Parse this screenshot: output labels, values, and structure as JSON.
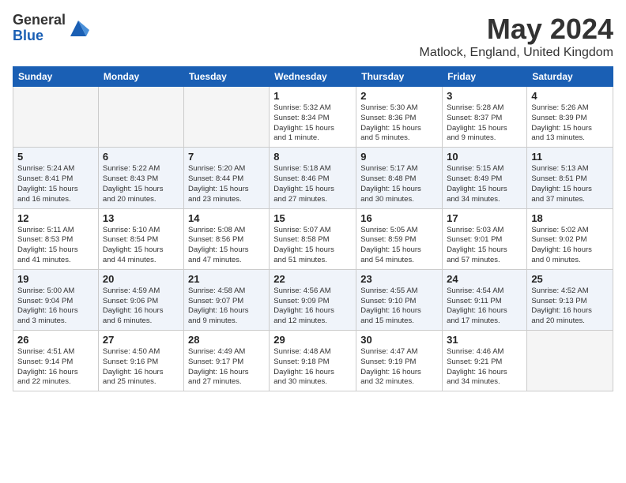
{
  "logo": {
    "general": "General",
    "blue": "Blue"
  },
  "title": "May 2024",
  "location": "Matlock, England, United Kingdom",
  "days_of_week": [
    "Sunday",
    "Monday",
    "Tuesday",
    "Wednesday",
    "Thursday",
    "Friday",
    "Saturday"
  ],
  "weeks": [
    [
      {
        "num": "",
        "info": ""
      },
      {
        "num": "",
        "info": ""
      },
      {
        "num": "",
        "info": ""
      },
      {
        "num": "1",
        "info": "Sunrise: 5:32 AM\nSunset: 8:34 PM\nDaylight: 15 hours\nand 1 minute."
      },
      {
        "num": "2",
        "info": "Sunrise: 5:30 AM\nSunset: 8:36 PM\nDaylight: 15 hours\nand 5 minutes."
      },
      {
        "num": "3",
        "info": "Sunrise: 5:28 AM\nSunset: 8:37 PM\nDaylight: 15 hours\nand 9 minutes."
      },
      {
        "num": "4",
        "info": "Sunrise: 5:26 AM\nSunset: 8:39 PM\nDaylight: 15 hours\nand 13 minutes."
      }
    ],
    [
      {
        "num": "5",
        "info": "Sunrise: 5:24 AM\nSunset: 8:41 PM\nDaylight: 15 hours\nand 16 minutes."
      },
      {
        "num": "6",
        "info": "Sunrise: 5:22 AM\nSunset: 8:43 PM\nDaylight: 15 hours\nand 20 minutes."
      },
      {
        "num": "7",
        "info": "Sunrise: 5:20 AM\nSunset: 8:44 PM\nDaylight: 15 hours\nand 23 minutes."
      },
      {
        "num": "8",
        "info": "Sunrise: 5:18 AM\nSunset: 8:46 PM\nDaylight: 15 hours\nand 27 minutes."
      },
      {
        "num": "9",
        "info": "Sunrise: 5:17 AM\nSunset: 8:48 PM\nDaylight: 15 hours\nand 30 minutes."
      },
      {
        "num": "10",
        "info": "Sunrise: 5:15 AM\nSunset: 8:49 PM\nDaylight: 15 hours\nand 34 minutes."
      },
      {
        "num": "11",
        "info": "Sunrise: 5:13 AM\nSunset: 8:51 PM\nDaylight: 15 hours\nand 37 minutes."
      }
    ],
    [
      {
        "num": "12",
        "info": "Sunrise: 5:11 AM\nSunset: 8:53 PM\nDaylight: 15 hours\nand 41 minutes."
      },
      {
        "num": "13",
        "info": "Sunrise: 5:10 AM\nSunset: 8:54 PM\nDaylight: 15 hours\nand 44 minutes."
      },
      {
        "num": "14",
        "info": "Sunrise: 5:08 AM\nSunset: 8:56 PM\nDaylight: 15 hours\nand 47 minutes."
      },
      {
        "num": "15",
        "info": "Sunrise: 5:07 AM\nSunset: 8:58 PM\nDaylight: 15 hours\nand 51 minutes."
      },
      {
        "num": "16",
        "info": "Sunrise: 5:05 AM\nSunset: 8:59 PM\nDaylight: 15 hours\nand 54 minutes."
      },
      {
        "num": "17",
        "info": "Sunrise: 5:03 AM\nSunset: 9:01 PM\nDaylight: 15 hours\nand 57 minutes."
      },
      {
        "num": "18",
        "info": "Sunrise: 5:02 AM\nSunset: 9:02 PM\nDaylight: 16 hours\nand 0 minutes."
      }
    ],
    [
      {
        "num": "19",
        "info": "Sunrise: 5:00 AM\nSunset: 9:04 PM\nDaylight: 16 hours\nand 3 minutes."
      },
      {
        "num": "20",
        "info": "Sunrise: 4:59 AM\nSunset: 9:06 PM\nDaylight: 16 hours\nand 6 minutes."
      },
      {
        "num": "21",
        "info": "Sunrise: 4:58 AM\nSunset: 9:07 PM\nDaylight: 16 hours\nand 9 minutes."
      },
      {
        "num": "22",
        "info": "Sunrise: 4:56 AM\nSunset: 9:09 PM\nDaylight: 16 hours\nand 12 minutes."
      },
      {
        "num": "23",
        "info": "Sunrise: 4:55 AM\nSunset: 9:10 PM\nDaylight: 16 hours\nand 15 minutes."
      },
      {
        "num": "24",
        "info": "Sunrise: 4:54 AM\nSunset: 9:11 PM\nDaylight: 16 hours\nand 17 minutes."
      },
      {
        "num": "25",
        "info": "Sunrise: 4:52 AM\nSunset: 9:13 PM\nDaylight: 16 hours\nand 20 minutes."
      }
    ],
    [
      {
        "num": "26",
        "info": "Sunrise: 4:51 AM\nSunset: 9:14 PM\nDaylight: 16 hours\nand 22 minutes."
      },
      {
        "num": "27",
        "info": "Sunrise: 4:50 AM\nSunset: 9:16 PM\nDaylight: 16 hours\nand 25 minutes."
      },
      {
        "num": "28",
        "info": "Sunrise: 4:49 AM\nSunset: 9:17 PM\nDaylight: 16 hours\nand 27 minutes."
      },
      {
        "num": "29",
        "info": "Sunrise: 4:48 AM\nSunset: 9:18 PM\nDaylight: 16 hours\nand 30 minutes."
      },
      {
        "num": "30",
        "info": "Sunrise: 4:47 AM\nSunset: 9:19 PM\nDaylight: 16 hours\nand 32 minutes."
      },
      {
        "num": "31",
        "info": "Sunrise: 4:46 AM\nSunset: 9:21 PM\nDaylight: 16 hours\nand 34 minutes."
      },
      {
        "num": "",
        "info": ""
      }
    ]
  ]
}
